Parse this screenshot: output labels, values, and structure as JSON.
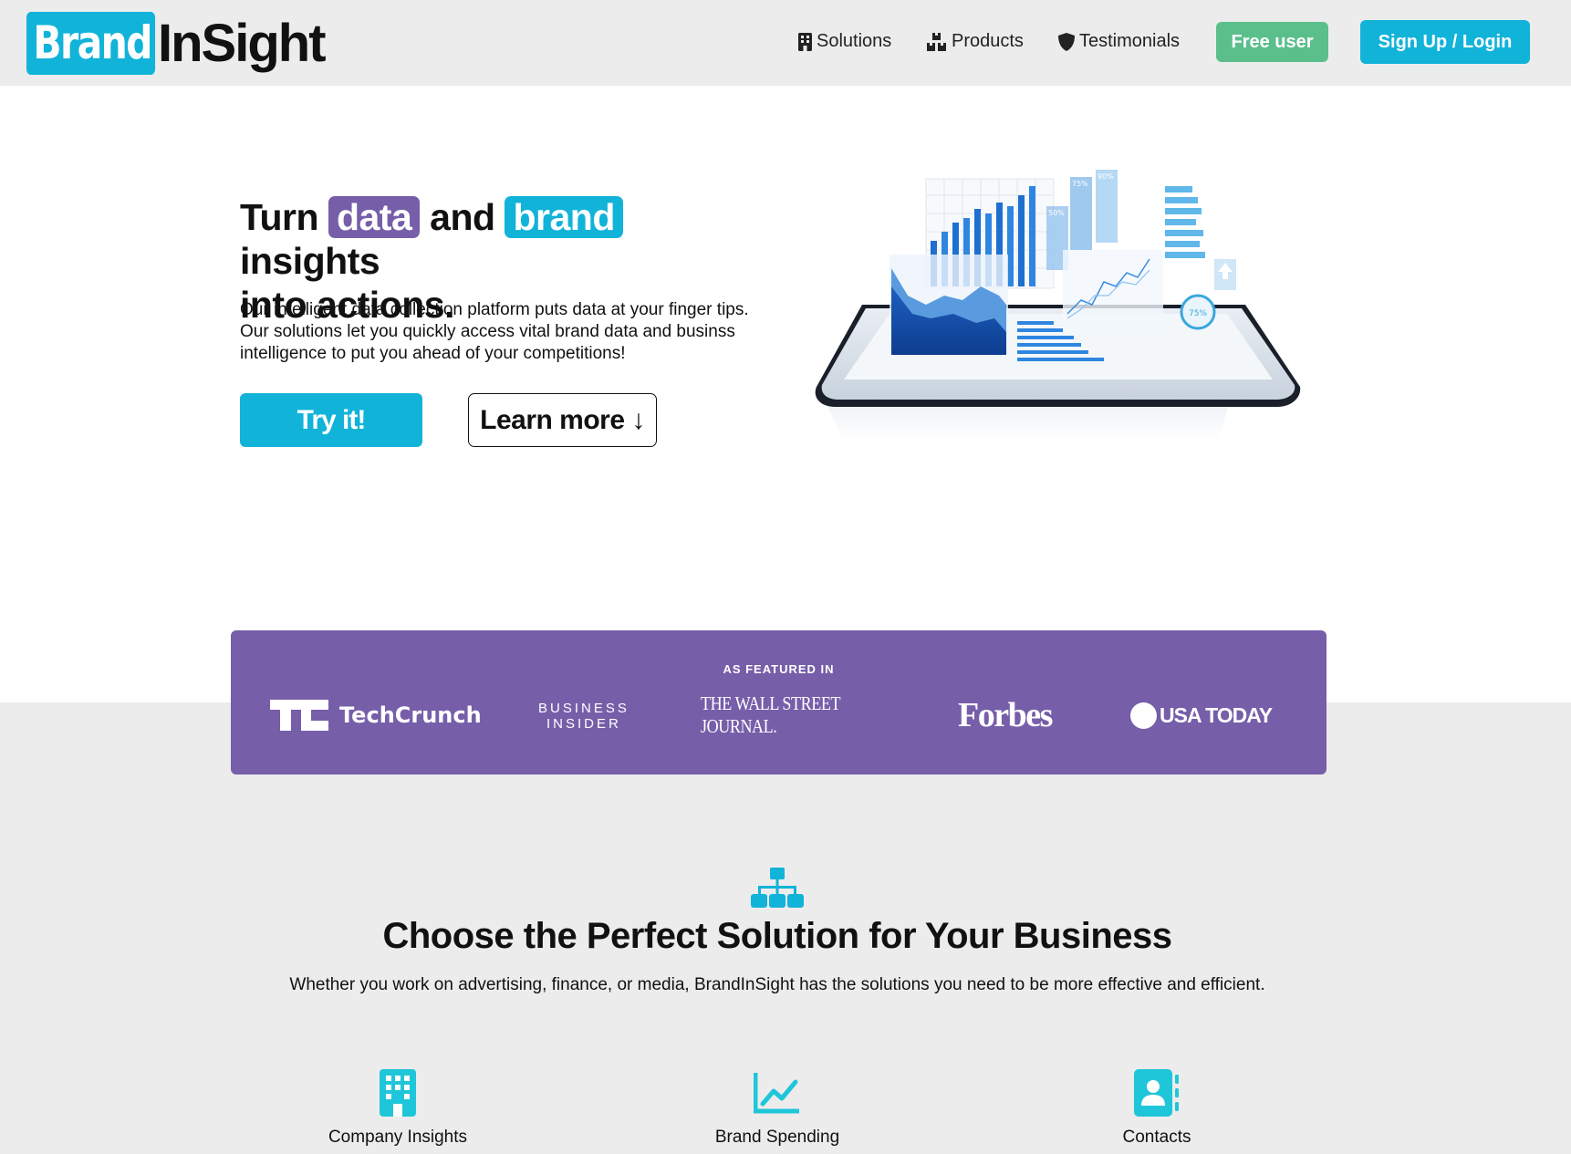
{
  "logo": {
    "brand": "Brand",
    "insight": "InSight"
  },
  "nav": {
    "solutions": "Solutions",
    "products": "Products",
    "testimonials": "Testimonials",
    "free_user": "Free user",
    "signup": "Sign Up / Login"
  },
  "hero": {
    "title_1": "Turn",
    "title_data": "data",
    "title_and": "and",
    "title_brand": "brand",
    "title_2": "insights",
    "title_3": "into actions.",
    "description": "Our intelligent data collection platform puts data at your finger tips. Our solutions let you quickly access vital brand data and businss intelligence to put you ahead of your competitions!",
    "try_label": "Try it!",
    "learn_label": "Learn more ↓"
  },
  "illustration": {
    "labels": [
      "75%",
      "90%",
      "50%",
      "75%"
    ]
  },
  "featured": {
    "label": "AS FEATURED IN",
    "techcrunch": "TechCrunch",
    "bi_line1": "BUSINESS",
    "bi_line2": "INSIDER",
    "wsj": "THE WALL STREET JOURNAL.",
    "forbes": "Forbes",
    "usatoday": "USA TODAY"
  },
  "solutions": {
    "title": "Choose the Perfect Solution for Your Business",
    "subtitle": "Whether you work on advertising, finance, or media, BrandInSight has the solutions you need to be more effective and efficient.",
    "cards": [
      {
        "label": "Company Insights",
        "icon": "building-icon"
      },
      {
        "label": "Brand Spending",
        "icon": "line-chart-icon"
      },
      {
        "label": "Contacts",
        "icon": "contact-book-icon"
      }
    ]
  },
  "colors": {
    "accent": "#11b3d9",
    "purple": "#765ea9",
    "green": "#5bbf8c"
  }
}
